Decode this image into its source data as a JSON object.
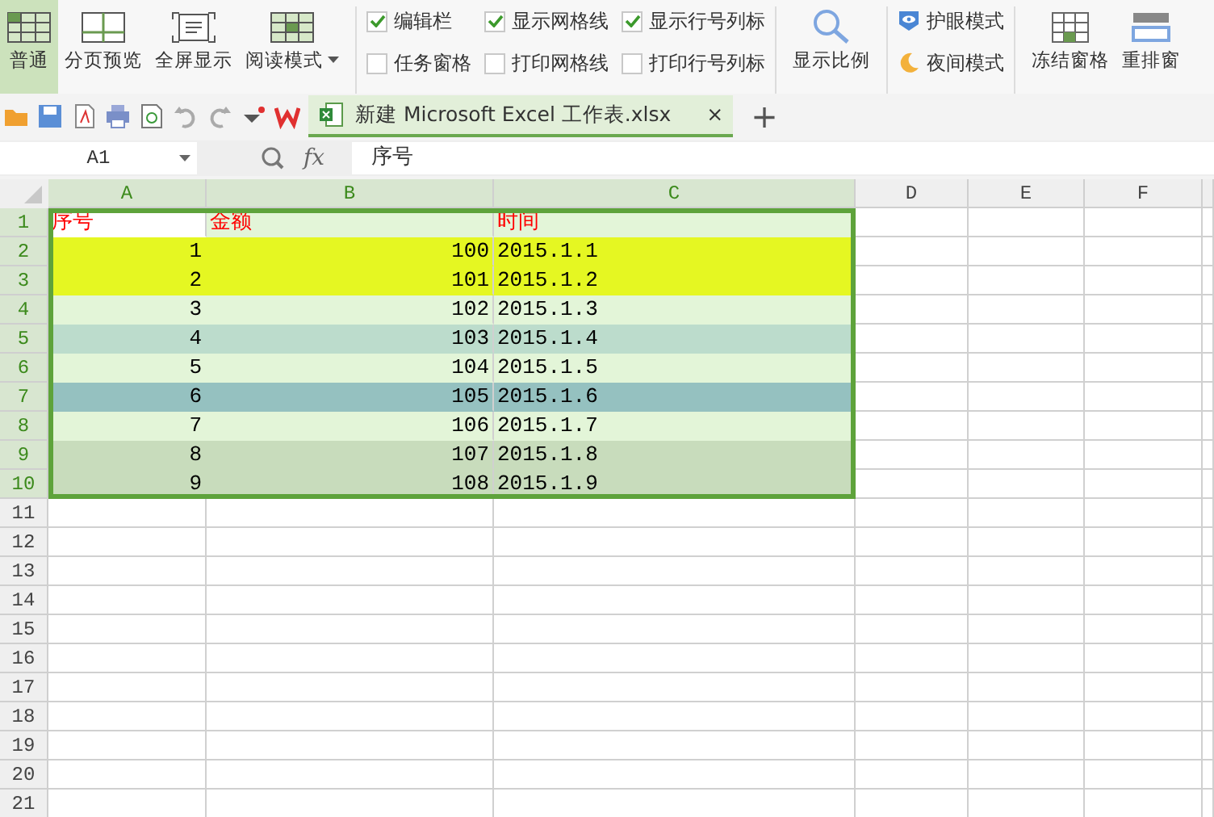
{
  "ribbon": {
    "view_buttons": [
      {
        "label": "普通",
        "kind": "normal",
        "selected": true
      },
      {
        "label": "分页预览",
        "kind": "pages",
        "selected": false
      },
      {
        "label": "全屏显示",
        "kind": "fullscreen",
        "selected": false
      },
      {
        "label": "阅读模式",
        "kind": "reading",
        "selected": false,
        "has_menu": true
      }
    ],
    "checkboxes": [
      {
        "label": "编辑栏",
        "checked": true
      },
      {
        "label": "任务窗格",
        "checked": false
      },
      {
        "label": "显示网格线",
        "checked": true
      },
      {
        "label": "打印网格线",
        "checked": false
      },
      {
        "label": "显示行号列标",
        "checked": true
      },
      {
        "label": "打印行号列标",
        "checked": false
      }
    ],
    "zoom_button": {
      "label": "显示比例"
    },
    "modes": [
      {
        "label": "护眼模式",
        "kind": "eye"
      },
      {
        "label": "夜间模式",
        "kind": "moon"
      }
    ],
    "right_buttons": [
      {
        "label": "冻结窗格",
        "kind": "freeze"
      },
      {
        "label": "重排窗",
        "kind": "arrange"
      }
    ]
  },
  "document_tab": {
    "title": "新建 Microsoft Excel 工作表.xlsx",
    "close": "×",
    "new_tab": "+"
  },
  "formula_bar": {
    "name_box": "A1",
    "fx": "fx",
    "value": "序号"
  },
  "sheet": {
    "columns": [
      {
        "label": "A",
        "selected": true
      },
      {
        "label": "B",
        "selected": true
      },
      {
        "label": "C",
        "selected": true
      },
      {
        "label": "D",
        "selected": false
      },
      {
        "label": "E",
        "selected": false
      },
      {
        "label": "F",
        "selected": false
      }
    ],
    "rows": [
      {
        "header": "1",
        "selected": true,
        "kind": "header",
        "color": "#e3f5d8",
        "cells": [
          {
            "text": "序号",
            "active": true
          },
          {
            "text": "金额"
          },
          {
            "text": "时间"
          }
        ]
      },
      {
        "header": "2",
        "selected": true,
        "kind": "data",
        "color": "#e5f722",
        "cells": [
          {
            "text": "1"
          },
          {
            "text": "100"
          },
          {
            "text": "2015.1.1"
          }
        ]
      },
      {
        "header": "3",
        "selected": true,
        "kind": "data",
        "color": "#e5f722",
        "cells": [
          {
            "text": "2"
          },
          {
            "text": "101"
          },
          {
            "text": "2015.1.2"
          }
        ]
      },
      {
        "header": "4",
        "selected": true,
        "kind": "data",
        "color": "#e3f5d8",
        "cells": [
          {
            "text": "3"
          },
          {
            "text": "102"
          },
          {
            "text": "2015.1.3"
          }
        ]
      },
      {
        "header": "5",
        "selected": true,
        "kind": "data",
        "color": "#bcdccc",
        "cells": [
          {
            "text": "4"
          },
          {
            "text": "103"
          },
          {
            "text": "2015.1.4"
          }
        ]
      },
      {
        "header": "6",
        "selected": true,
        "kind": "data",
        "color": "#e3f5d8",
        "cells": [
          {
            "text": "5"
          },
          {
            "text": "104"
          },
          {
            "text": "2015.1.5"
          }
        ]
      },
      {
        "header": "7",
        "selected": true,
        "kind": "data",
        "color": "#95c1c0",
        "cells": [
          {
            "text": "6"
          },
          {
            "text": "105"
          },
          {
            "text": "2015.1.6"
          }
        ]
      },
      {
        "header": "8",
        "selected": true,
        "kind": "data",
        "color": "#e3f5d8",
        "cells": [
          {
            "text": "7"
          },
          {
            "text": "106"
          },
          {
            "text": "2015.1.7"
          }
        ]
      },
      {
        "header": "9",
        "selected": true,
        "kind": "data",
        "color": "#c8dcbc",
        "cells": [
          {
            "text": "8"
          },
          {
            "text": "107"
          },
          {
            "text": "2015.1.8"
          }
        ]
      },
      {
        "header": "10",
        "selected": true,
        "kind": "data",
        "color": "#c8dcbc",
        "cells": [
          {
            "text": "9"
          },
          {
            "text": "108"
          },
          {
            "text": "2015.1.9"
          }
        ]
      },
      {
        "header": "11",
        "selected": false
      },
      {
        "header": "12",
        "selected": false
      },
      {
        "header": "13",
        "selected": false
      },
      {
        "header": "14",
        "selected": false
      },
      {
        "header": "15",
        "selected": false
      },
      {
        "header": "16",
        "selected": false
      },
      {
        "header": "17",
        "selected": false
      },
      {
        "header": "18",
        "selected": false
      },
      {
        "header": "19",
        "selected": false
      },
      {
        "header": "20",
        "selected": false
      },
      {
        "header": "21",
        "selected": false
      }
    ]
  }
}
